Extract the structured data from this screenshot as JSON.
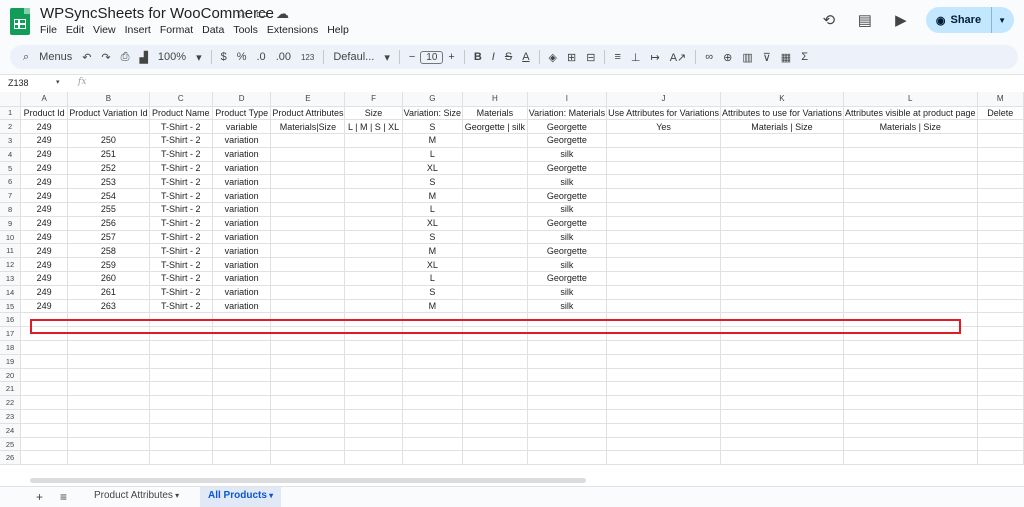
{
  "app": {
    "title": "WPSyncSheets for WooCommerce",
    "menus": [
      "File",
      "Edit",
      "View",
      "Insert",
      "Format",
      "Data",
      "Tools",
      "Extensions",
      "Help"
    ],
    "share_label": "Share"
  },
  "toolbar": {
    "menus_label": "Menus",
    "zoom": "100%",
    "currency": "$",
    "percent": "%",
    "decrease_decimal": ".0",
    "increase_decimal": ".00",
    "number_format": "123",
    "font": "Defaul...",
    "font_size": "10"
  },
  "formula_bar": {
    "name_box": "Z138",
    "fx": "fx"
  },
  "columns": [
    "A",
    "B",
    "C",
    "D",
    "E",
    "F",
    "G",
    "H",
    "I",
    "J",
    "K",
    "L",
    "M"
  ],
  "header_row": [
    "Product Id",
    "Product Variation Id",
    "Product Name",
    "Product Type",
    "Product Attributes",
    "Size",
    "Variation: Size",
    "Materials",
    "Variation: Materials",
    "Use Attributes for Variations",
    "Attributes to use for Variations",
    "Attributes visible at product page",
    "Delete"
  ],
  "rows": [
    [
      "249",
      "",
      "T-Shirt - 2",
      "variable",
      "Materials|Size",
      "L | M | S | XL",
      "S",
      "Georgette | silk",
      "Georgette",
      "Yes",
      "Materials | Size",
      "Materials | Size",
      ""
    ],
    [
      "249",
      "250",
      "T-Shirt - 2",
      "variation",
      "",
      "",
      "M",
      "",
      "Georgette",
      "",
      "",
      "",
      ""
    ],
    [
      "249",
      "251",
      "T-Shirt - 2",
      "variation",
      "",
      "",
      "L",
      "",
      "silk",
      "",
      "",
      "",
      ""
    ],
    [
      "249",
      "252",
      "T-Shirt - 2",
      "variation",
      "",
      "",
      "XL",
      "",
      "Georgette",
      "",
      "",
      "",
      ""
    ],
    [
      "249",
      "253",
      "T-Shirt - 2",
      "variation",
      "",
      "",
      "S",
      "",
      "silk",
      "",
      "",
      "",
      ""
    ],
    [
      "249",
      "254",
      "T-Shirt - 2",
      "variation",
      "",
      "",
      "M",
      "",
      "Georgette",
      "",
      "",
      "",
      ""
    ],
    [
      "249",
      "255",
      "T-Shirt - 2",
      "variation",
      "",
      "",
      "L",
      "",
      "silk",
      "",
      "",
      "",
      ""
    ],
    [
      "249",
      "256",
      "T-Shirt - 2",
      "variation",
      "",
      "",
      "XL",
      "",
      "Georgette",
      "",
      "",
      "",
      ""
    ],
    [
      "249",
      "257",
      "T-Shirt - 2",
      "variation",
      "",
      "",
      "S",
      "",
      "silk",
      "",
      "",
      "",
      ""
    ],
    [
      "249",
      "258",
      "T-Shirt - 2",
      "variation",
      "",
      "",
      "M",
      "",
      "Georgette",
      "",
      "",
      "",
      ""
    ],
    [
      "249",
      "259",
      "T-Shirt - 2",
      "variation",
      "",
      "",
      "XL",
      "",
      "silk",
      "",
      "",
      "",
      ""
    ],
    [
      "249",
      "260",
      "T-Shirt - 2",
      "variation",
      "",
      "",
      "L",
      "",
      "Georgette",
      "",
      "",
      "",
      ""
    ],
    [
      "249",
      "261",
      "T-Shirt - 2",
      "variation",
      "",
      "",
      "S",
      "",
      "silk",
      "",
      "",
      "",
      ""
    ],
    [
      "249",
      "263",
      "T-Shirt - 2",
      "variation",
      "",
      "",
      "M",
      "",
      "silk",
      "",
      "",
      "",
      ""
    ]
  ],
  "empty_row_numbers": [
    "16",
    "17",
    "18",
    "19",
    "20",
    "21",
    "22",
    "23",
    "24",
    "25",
    "26"
  ],
  "sheet_tabs": [
    {
      "label": "Product Attributes",
      "active": false
    },
    {
      "label": "All Products",
      "active": true
    }
  ],
  "colors": {
    "accent": "#0b57d0",
    "highlight": "#e01b24",
    "share_bg": "#c2e7ff"
  }
}
